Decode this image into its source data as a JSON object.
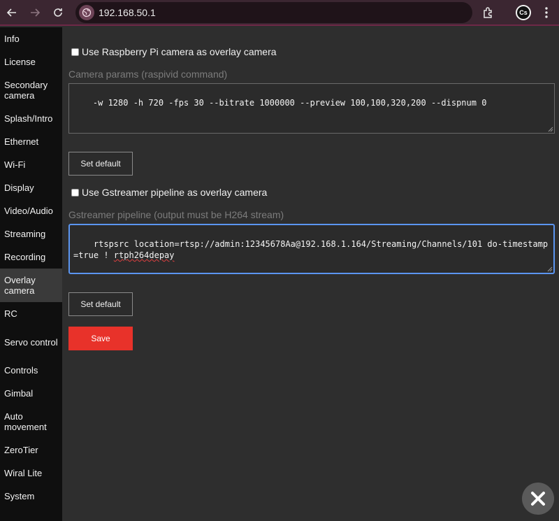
{
  "browser": {
    "url": "192.168.50.1",
    "profile_initials": "Cs",
    "accent_color": "#6e2847"
  },
  "sidebar": {
    "items": [
      {
        "label": "Info"
      },
      {
        "label": "License"
      },
      {
        "label": "Secondary camera"
      },
      {
        "label": "Splash/Intro"
      },
      {
        "label": "Ethernet"
      },
      {
        "label": "Wi-Fi"
      },
      {
        "label": "Display"
      },
      {
        "label": "Video/Audio"
      },
      {
        "label": "Streaming"
      },
      {
        "label": "Recording"
      },
      {
        "label": "Overlay camera",
        "active": true
      },
      {
        "label": "RC"
      },
      {
        "label": "Servo control"
      },
      {
        "label": "Controls"
      },
      {
        "label": "Gimbal"
      },
      {
        "label": "Auto movement"
      },
      {
        "label": "ZeroTier"
      },
      {
        "label": "Wiral Lite"
      },
      {
        "label": "System"
      }
    ]
  },
  "main": {
    "rpi_checkbox_label": "Use Raspberry Pi camera as overlay camera",
    "rpi_checked": false,
    "camera_params_label": "Camera params (raspivid command)",
    "camera_params_value": "-w 1280 -h 720 -fps 30 --bitrate 1000000 --preview 100,100,320,200 --dispnum 0",
    "set_default_1": "Set default",
    "gst_checkbox_label": "Use Gstreamer pipeline as overlay camera",
    "gst_checked": false,
    "gst_pipeline_label": "Gstreamer pipeline (output must be H264 stream)",
    "gst_pipeline_value_part1": "rtspsrc location=rtsp://admin:12345678Aa@192.168.1.164/Streaming/Channels/101 do-timestamp=true ! ",
    "gst_pipeline_value_part2": "rtph264depay",
    "set_default_2": "Set default",
    "save_label": "Save",
    "save_color": "#e8322a"
  },
  "icons": {
    "back": "arrow-left-icon",
    "forward": "arrow-right-icon",
    "reload": "reload-icon",
    "site_info": "site-info-icon",
    "extensions": "extensions-icon",
    "menu": "kebab-menu-icon",
    "close": "close-icon"
  }
}
